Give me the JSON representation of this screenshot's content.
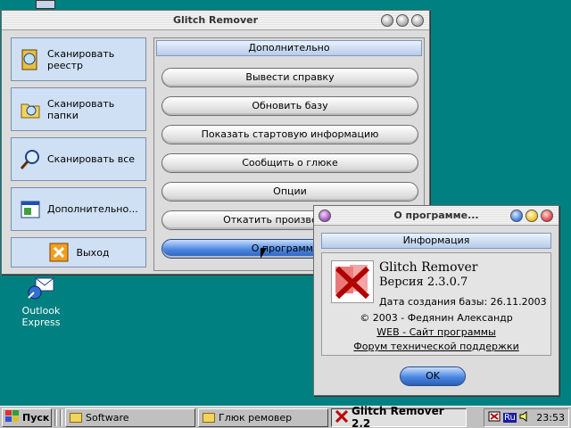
{
  "desktop": {
    "icon_label": "Outlook Express"
  },
  "main_window": {
    "title": "Glitch Remover",
    "side_buttons": [
      {
        "label": "Сканировать реестр"
      },
      {
        "label": "Сканировать папки"
      },
      {
        "label": "Сканировать все"
      },
      {
        "label": "Дополнительно..."
      },
      {
        "label": "Выход"
      }
    ],
    "panel_title": "Дополнительно",
    "actions": [
      {
        "label": "Вывести справку"
      },
      {
        "label": "Обновить базу"
      },
      {
        "label": "Показать стартовую информацию"
      },
      {
        "label": "Сообщить о глюке"
      },
      {
        "label": "Опции"
      },
      {
        "label": "Откатить произведенные"
      },
      {
        "label": "О программе..."
      }
    ]
  },
  "about_dialog": {
    "title": "О программе...",
    "section_title": "Информация",
    "app_name": "Glitch Remover",
    "version": "Версия 2.3.0.7",
    "db_date": "Дата создания базы: 26.11.2003",
    "copyright": "© 2003 - Федянин Александр",
    "web_link": "WEB - Сайт программы",
    "forum_link": "Форум технической поддержки",
    "ok_label": "OK"
  },
  "taskbar": {
    "start_label": "Пуск",
    "tasks": [
      {
        "label": "Software"
      },
      {
        "label": "Глюк ремовер"
      },
      {
        "label": "Glitch Remover 2.2"
      }
    ],
    "lang": "Ru",
    "time": "23:53"
  },
  "colors": {
    "desktop": "#008080",
    "accent_blue": "#4a86e0"
  }
}
